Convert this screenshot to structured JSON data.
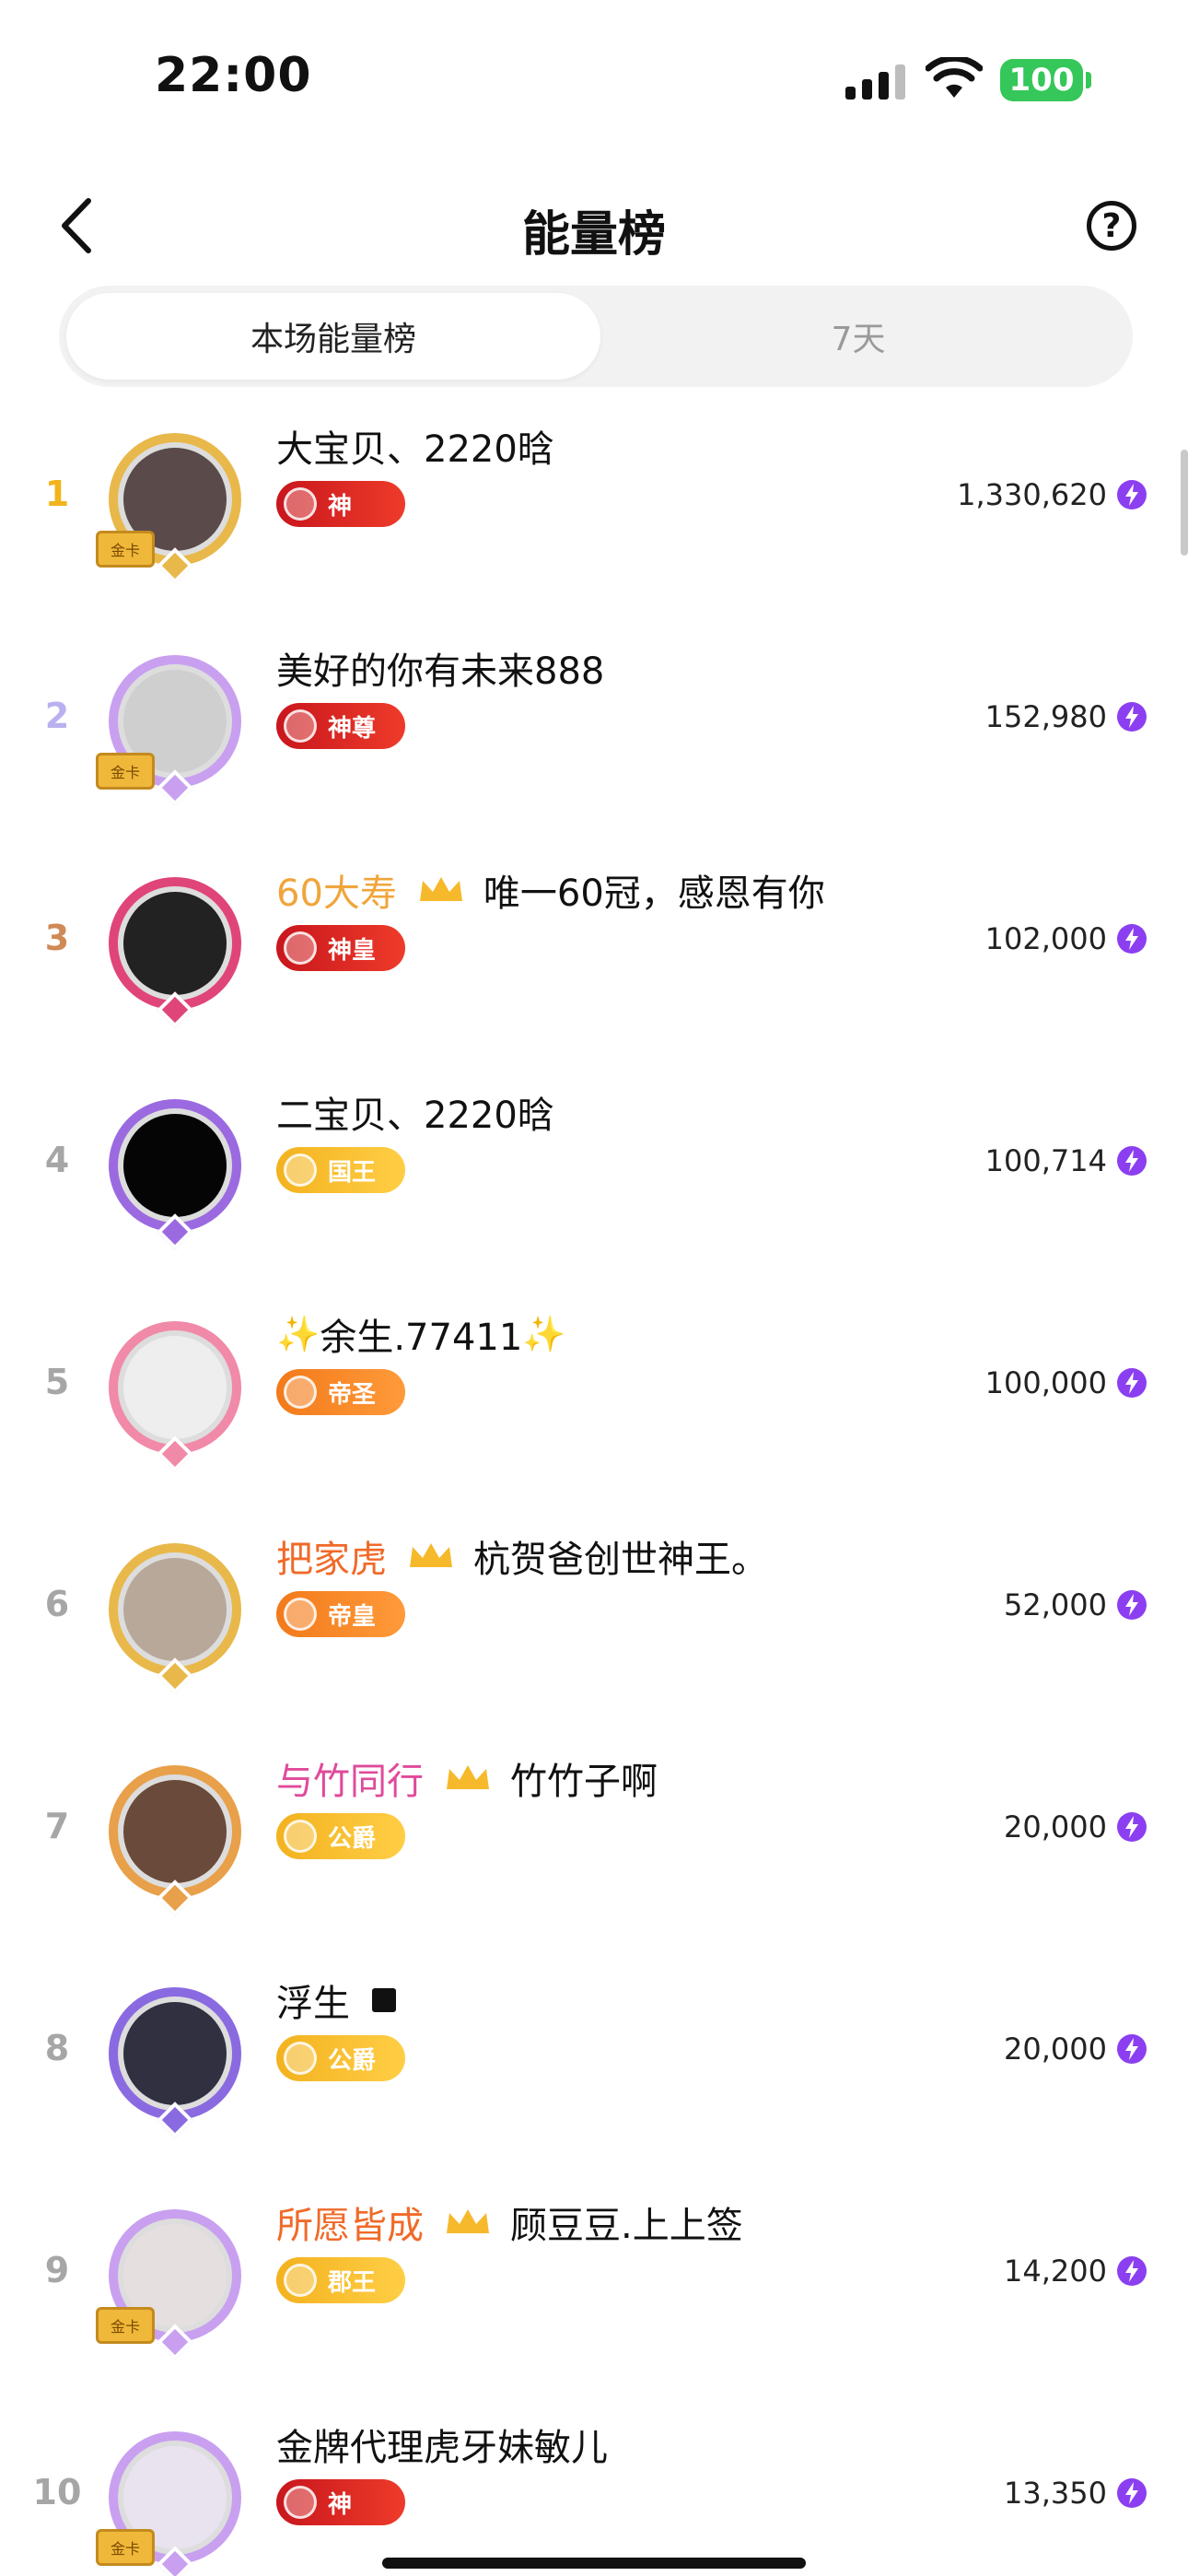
{
  "status_bar": {
    "time": "22:00",
    "battery": "100"
  },
  "header": {
    "title": "能量榜",
    "help_glyph": "?"
  },
  "tabs": [
    {
      "label": "本场能量榜",
      "active": true
    },
    {
      "label": "7天",
      "active": false
    }
  ],
  "colors": {
    "rank1": "#f1b41d",
    "rank2": "#b9b0ef",
    "rank3": "#d08a56",
    "rank_other": "#a6a6a6",
    "energy": "#8b3ff0",
    "battery": "#35c759"
  },
  "rankings": [
    {
      "rank": "1",
      "name": "大宝贝、2220晗",
      "badge": "神",
      "score": "1,330,620"
    },
    {
      "rank": "2",
      "name": "美好的你有未来888",
      "badge": "神尊",
      "score": "152,980"
    },
    {
      "rank": "3",
      "name_prefix": "60大寿",
      "name": "唯一60冠，感恩有你",
      "badge": "神皇",
      "score": "102,000"
    },
    {
      "rank": "4",
      "name": "二宝贝、2220晗",
      "badge": "国王",
      "score": "100,714"
    },
    {
      "rank": "5",
      "name": "余生.77411",
      "badge": "帝圣",
      "score": "100,000"
    },
    {
      "rank": "6",
      "name_prefix": "把家虎",
      "name": "杭贺爸创世神王。",
      "badge": "帝皇",
      "score": "52,000"
    },
    {
      "rank": "7",
      "name_prefix": "与竹同行",
      "name": "竹竹子啊",
      "badge": "公爵",
      "score": "20,000"
    },
    {
      "rank": "8",
      "name": "浮生",
      "badge": "公爵",
      "score": "20,000"
    },
    {
      "rank": "9",
      "name_prefix": "所愿皆成",
      "name": "顾豆豆.上上签",
      "badge": "郡王",
      "score": "14,200"
    },
    {
      "rank": "10",
      "name": "金牌代理虎牙妹敏儿",
      "badge": "神",
      "score": "13,350"
    }
  ],
  "card_label": "金卡"
}
